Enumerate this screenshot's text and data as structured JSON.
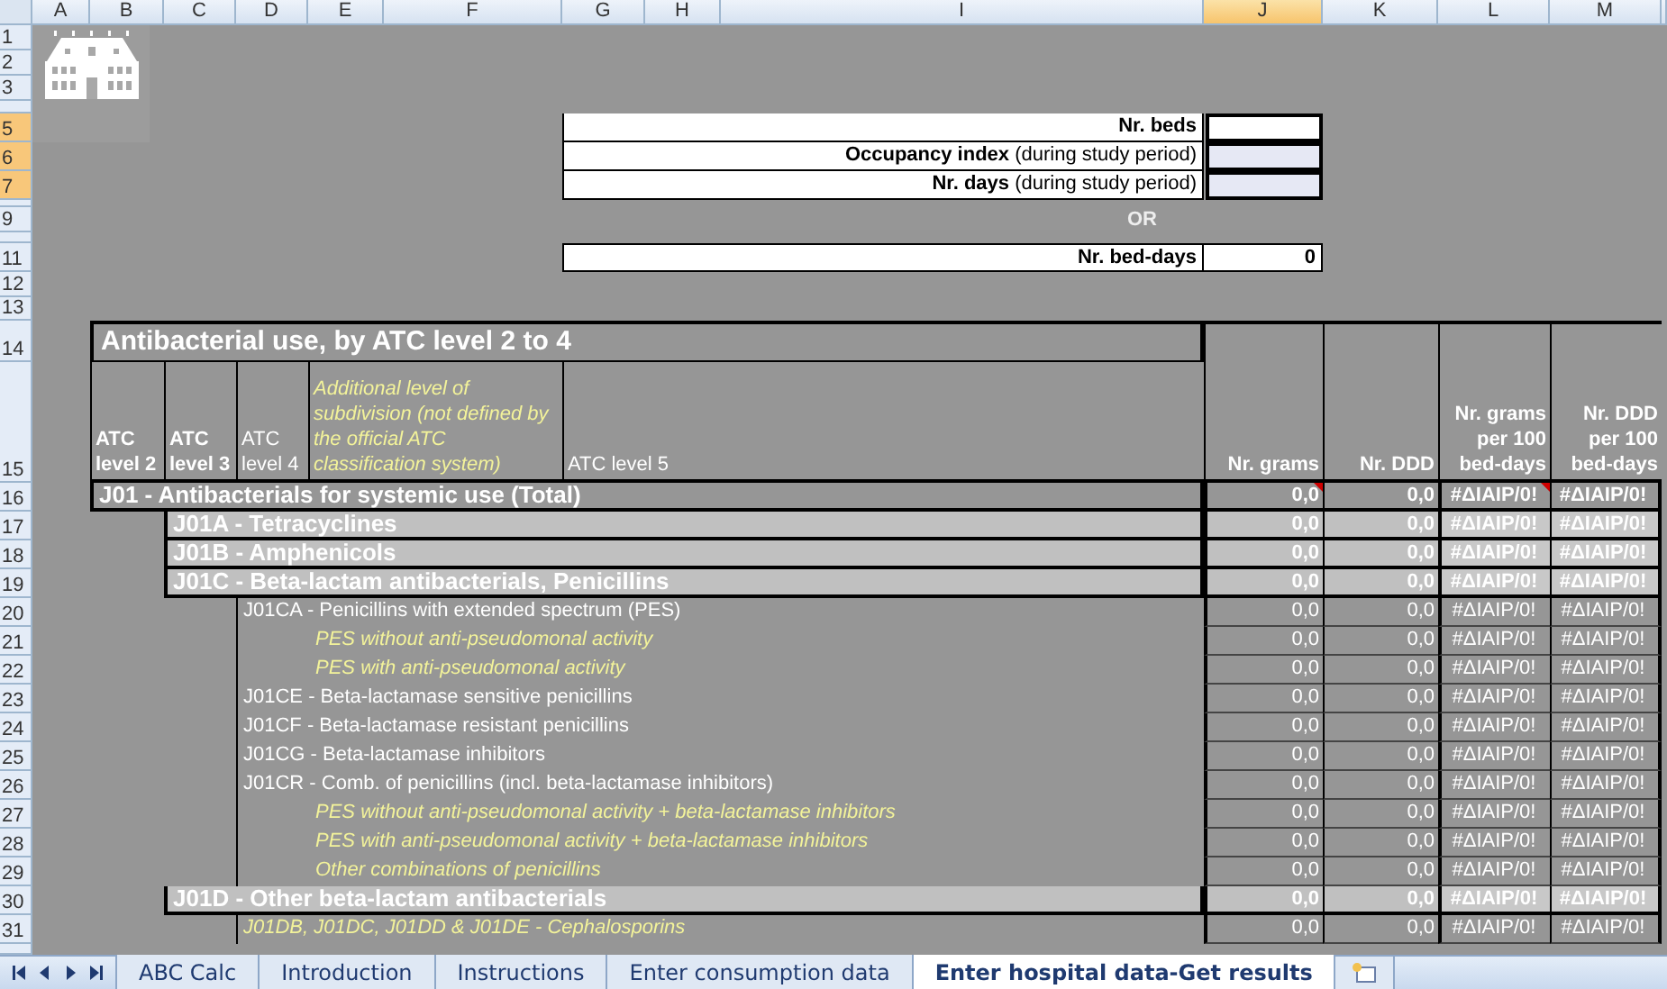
{
  "column_headers": [
    {
      "label": "A",
      "selected": false
    },
    {
      "label": "B",
      "selected": false
    },
    {
      "label": "C",
      "selected": false
    },
    {
      "label": "D",
      "selected": false
    },
    {
      "label": "E",
      "selected": false
    },
    {
      "label": "F",
      "selected": false
    },
    {
      "label": "G",
      "selected": false
    },
    {
      "label": "H",
      "selected": false
    },
    {
      "label": "I",
      "selected": false
    },
    {
      "label": "J",
      "selected": true
    },
    {
      "label": "K",
      "selected": false
    },
    {
      "label": "L",
      "selected": false
    },
    {
      "label": "M",
      "selected": false
    }
  ],
  "row_headers": [
    {
      "label": "1",
      "selected": false
    },
    {
      "label": "2",
      "selected": false
    },
    {
      "label": "3",
      "selected": false
    },
    {
      "label": "5",
      "selected": true
    },
    {
      "label": "6",
      "selected": true
    },
    {
      "label": "7",
      "selected": true
    },
    {
      "label": "9",
      "selected": false
    },
    {
      "label": "11",
      "selected": false
    },
    {
      "label": "12",
      "selected": false
    },
    {
      "label": "13",
      "selected": false
    },
    {
      "label": "14",
      "selected": false
    },
    {
      "label": "15",
      "selected": false
    },
    {
      "label": "16",
      "selected": false
    },
    {
      "label": "17",
      "selected": false
    },
    {
      "label": "18",
      "selected": false
    },
    {
      "label": "19",
      "selected": false
    },
    {
      "label": "20",
      "selected": false
    },
    {
      "label": "21",
      "selected": false
    },
    {
      "label": "22",
      "selected": false
    },
    {
      "label": "23",
      "selected": false
    },
    {
      "label": "24",
      "selected": false
    },
    {
      "label": "25",
      "selected": false
    },
    {
      "label": "26",
      "selected": false
    },
    {
      "label": "27",
      "selected": false
    },
    {
      "label": "28",
      "selected": false
    },
    {
      "label": "29",
      "selected": false
    },
    {
      "label": "30",
      "selected": false
    },
    {
      "label": "31",
      "selected": false
    }
  ],
  "bed_inputs": [
    {
      "label": "**Nr. beds**",
      "selected": true,
      "active": true
    },
    {
      "label": "**Occupancy index** (during study period)",
      "selected": true,
      "active": false
    },
    {
      "label": "**Nr. days** (during study period)",
      "selected": true,
      "active": false
    }
  ],
  "or_label": "OR",
  "bed_days": {
    "label": "Nr. bed-days",
    "value": "0"
  },
  "table": {
    "title": "Antibacterial use, by ATC level 2 to 4",
    "headers": [
      {
        "text": "ATC level 2",
        "kind": "bold"
      },
      {
        "text": "ATC level 3",
        "kind": "bold"
      },
      {
        "text": "ATC level 4",
        "kind": "plain"
      },
      {
        "text": "Additional level of subdivision (not defined by the official ATC classification system)",
        "kind": "note"
      },
      {
        "text": "ATC level 5",
        "kind": "plain"
      },
      {
        "text": "Nr. grams",
        "kind": "bold"
      },
      {
        "text": "Nr. DDD",
        "kind": "bold"
      },
      {
        "text": "Nr. grams per 100 bed-days",
        "kind": "bold"
      },
      {
        "text": "Nr. DDD per 100 bed-days",
        "kind": "bold"
      }
    ],
    "rows": [
      {
        "label": "J01 - Antibacterials for systemic use (Total)",
        "kind": "atc",
        "values": [
          {
            "text": "0,0",
            "comment": true
          },
          {
            "text": "0,0",
            "comment": false
          },
          {
            "text": "#ΔΙΑΙΡ/0!",
            "comment": true
          },
          {
            "text": "#ΔΙΑΙΡ/0!",
            "comment": false
          }
        ],
        "children": [
          {
            "label": "J01A - Tetracyclines",
            "kind": "atc",
            "values": [
              {
                "text": "0,0",
                "comment": false
              },
              {
                "text": "0,0",
                "comment": false
              },
              {
                "text": "#ΔΙΑΙΡ/0!",
                "comment": false
              },
              {
                "text": "#ΔΙΑΙΡ/0!",
                "comment": false
              }
            ]
          },
          {
            "label": "J01B - Amphenicols",
            "kind": "atc",
            "values": [
              {
                "text": "0,0",
                "comment": false
              },
              {
                "text": "0,0",
                "comment": false
              },
              {
                "text": "#ΔΙΑΙΡ/0!",
                "comment": false
              },
              {
                "text": "#ΔΙΑΙΡ/0!",
                "comment": false
              }
            ]
          },
          {
            "label": "J01C - Beta-lactam antibacterials, Penicillins",
            "kind": "atc",
            "values": [
              {
                "text": "0,0",
                "comment": false
              },
              {
                "text": "0,0",
                "comment": false
              },
              {
                "text": "#ΔΙΑΙΡ/0!",
                "comment": false
              },
              {
                "text": "#ΔΙΑΙΡ/0!",
                "comment": false
              }
            ],
            "children": [
              {
                "label": "J01CA - Penicillins with extended spectrum (PES)",
                "kind": "atc",
                "values": [
                  {
                    "text": "0,0",
                    "comment": false
                  },
                  {
                    "text": "0,0",
                    "comment": false
                  },
                  {
                    "text": "#ΔΙΑΙΡ/0!",
                    "comment": false
                  },
                  {
                    "text": "#ΔΙΑΙΡ/0!",
                    "comment": false
                  }
                ],
                "children": [
                  {
                    "label": "PES without anti-pseudomonal activity",
                    "kind": "note",
                    "values": [
                      {
                        "text": "0,0",
                        "comment": false
                      },
                      {
                        "text": "0,0",
                        "comment": false
                      },
                      {
                        "text": "#ΔΙΑΙΡ/0!",
                        "comment": false
                      },
                      {
                        "text": "#ΔΙΑΙΡ/0!",
                        "comment": false
                      }
                    ]
                  },
                  {
                    "label": "PES with anti-pseudomonal activity",
                    "kind": "note",
                    "values": [
                      {
                        "text": "0,0",
                        "comment": false
                      },
                      {
                        "text": "0,0",
                        "comment": false
                      },
                      {
                        "text": "#ΔΙΑΙΡ/0!",
                        "comment": false
                      },
                      {
                        "text": "#ΔΙΑΙΡ/0!",
                        "comment": false
                      }
                    ]
                  }
                ]
              },
              {
                "label": "J01CE - Beta-lactamase sensitive penicillins",
                "kind": "atc",
                "values": [
                  {
                    "text": "0,0",
                    "comment": false
                  },
                  {
                    "text": "0,0",
                    "comment": false
                  },
                  {
                    "text": "#ΔΙΑΙΡ/0!",
                    "comment": false
                  },
                  {
                    "text": "#ΔΙΑΙΡ/0!",
                    "comment": false
                  }
                ]
              },
              {
                "label": "J01CF - Beta-lactamase resistant penicillins",
                "kind": "atc",
                "values": [
                  {
                    "text": "0,0",
                    "comment": false
                  },
                  {
                    "text": "0,0",
                    "comment": false
                  },
                  {
                    "text": "#ΔΙΑΙΡ/0!",
                    "comment": false
                  },
                  {
                    "text": "#ΔΙΑΙΡ/0!",
                    "comment": false
                  }
                ]
              },
              {
                "label": "J01CG - Beta-lactamase inhibitors",
                "kind": "atc",
                "values": [
                  {
                    "text": "0,0",
                    "comment": false
                  },
                  {
                    "text": "0,0",
                    "comment": false
                  },
                  {
                    "text": "#ΔΙΑΙΡ/0!",
                    "comment": false
                  },
                  {
                    "text": "#ΔΙΑΙΡ/0!",
                    "comment": false
                  }
                ]
              },
              {
                "label": "J01CR - Comb. of penicillins (incl. beta-lactamase inhibitors)",
                "kind": "atc",
                "values": [
                  {
                    "text": "0,0",
                    "comment": false
                  },
                  {
                    "text": "0,0",
                    "comment": false
                  },
                  {
                    "text": "#ΔΙΑΙΡ/0!",
                    "comment": false
                  },
                  {
                    "text": "#ΔΙΑΙΡ/0!",
                    "comment": false
                  }
                ],
                "children": [
                  {
                    "label": "PES without anti-pseudomonal activity + beta-lactamase inhibitors",
                    "kind": "note",
                    "values": [
                      {
                        "text": "0,0",
                        "comment": false
                      },
                      {
                        "text": "0,0",
                        "comment": false
                      },
                      {
                        "text": "#ΔΙΑΙΡ/0!",
                        "comment": false
                      },
                      {
                        "text": "#ΔΙΑΙΡ/0!",
                        "comment": false
                      }
                    ]
                  },
                  {
                    "label": "PES with anti-pseudomonal activity + beta-lactamase inhibitors",
                    "kind": "note",
                    "values": [
                      {
                        "text": "0,0",
                        "comment": false
                      },
                      {
                        "text": "0,0",
                        "comment": false
                      },
                      {
                        "text": "#ΔΙΑΙΡ/0!",
                        "comment": false
                      },
                      {
                        "text": "#ΔΙΑΙΡ/0!",
                        "comment": false
                      }
                    ]
                  },
                  {
                    "label": "Other combinations of penicillins",
                    "kind": "note",
                    "values": [
                      {
                        "text": "0,0",
                        "comment": false
                      },
                      {
                        "text": "0,0",
                        "comment": false
                      },
                      {
                        "text": "#ΔΙΑΙΡ/0!",
                        "comment": false
                      },
                      {
                        "text": "#ΔΙΑΙΡ/0!",
                        "comment": false
                      }
                    ]
                  }
                ]
              }
            ]
          },
          {
            "label": "J01D - Other beta-lactam antibacterials",
            "kind": "atc",
            "values": [
              {
                "text": "0,0",
                "comment": false
              },
              {
                "text": "0,0",
                "comment": false
              },
              {
                "text": "#ΔΙΑΙΡ/0!",
                "comment": false
              },
              {
                "text": "#ΔΙΑΙΡ/0!",
                "comment": false
              }
            ],
            "children": [
              {
                "label": "J01DB, J01DC, J01DD & J01DE - Cephalosporins",
                "kind": "note",
                "values": [
                  {
                    "text": "0,0",
                    "comment": false
                  },
                  {
                    "text": "0,0",
                    "comment": false
                  },
                  {
                    "text": "#ΔΙΑΙΡ/0!",
                    "comment": false
                  },
                  {
                    "text": "#ΔΙΑΙΡ/0!",
                    "comment": false
                  }
                ]
              }
            ]
          }
        ]
      }
    ]
  },
  "sheet_tabs": [
    {
      "label": "ABC Calc",
      "selected": false
    },
    {
      "label": "Introduction",
      "selected": false
    },
    {
      "label": "Instructions",
      "selected": false
    },
    {
      "label": "Enter consumption data",
      "selected": false
    },
    {
      "label": "Enter hospital data-Get results",
      "selected": true
    }
  ]
}
